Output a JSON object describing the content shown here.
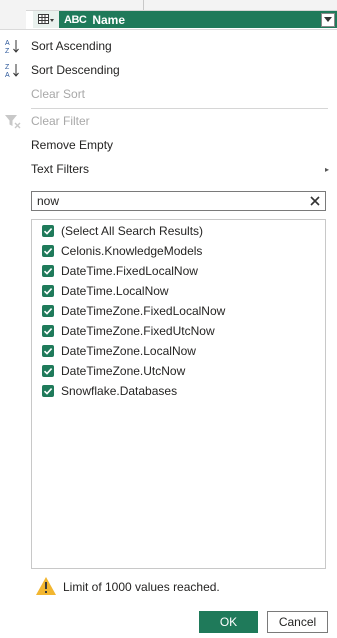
{
  "column_header": {
    "type_abc": "ABC",
    "name": "Name"
  },
  "menu": {
    "sort_ascending": "Sort Ascending",
    "sort_descending": "Sort Descending",
    "clear_sort": "Clear Sort",
    "clear_filter": "Clear Filter",
    "remove_empty": "Remove Empty",
    "text_filters": "Text Filters"
  },
  "search": {
    "value": "now"
  },
  "list": {
    "items": [
      {
        "label": "(Select All Search Results)",
        "checked": true
      },
      {
        "label": "Celonis.KnowledgeModels",
        "checked": true
      },
      {
        "label": "DateTime.FixedLocalNow",
        "checked": true
      },
      {
        "label": "DateTime.LocalNow",
        "checked": true
      },
      {
        "label": "DateTimeZone.FixedLocalNow",
        "checked": true
      },
      {
        "label": "DateTimeZone.FixedUtcNow",
        "checked": true
      },
      {
        "label": "DateTimeZone.LocalNow",
        "checked": true
      },
      {
        "label": "DateTimeZone.UtcNow",
        "checked": true
      },
      {
        "label": "Snowflake.Databases",
        "checked": true
      }
    ]
  },
  "warning": {
    "message": "Limit of 1000 values reached."
  },
  "buttons": {
    "ok": "OK",
    "cancel": "Cancel"
  },
  "colors": {
    "accent": "#1f7a5a",
    "warning": "#f2b630",
    "disabled_text": "#a8a8a8"
  }
}
